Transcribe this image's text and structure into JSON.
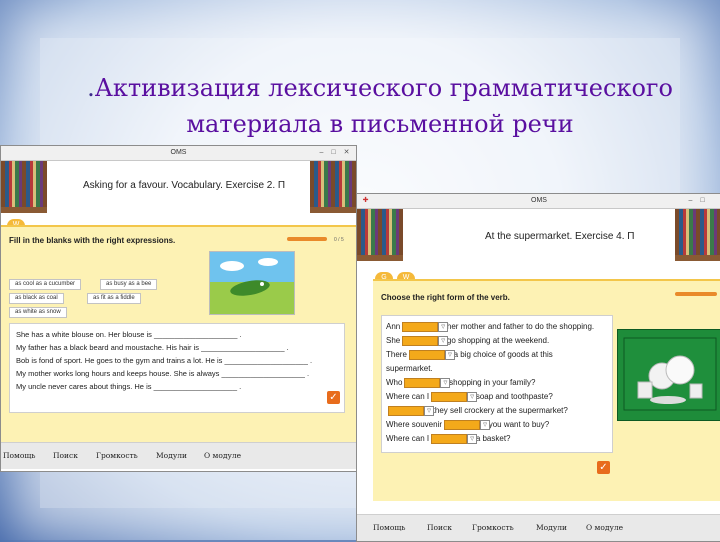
{
  "slide": {
    "title_line1": "Активизация лексического грамматического",
    "title_line2": "материала в письменной речи",
    "title_prefix": "."
  },
  "window1": {
    "titlebar": "OMS",
    "header": "Asking for a favour. Vocabulary. Exercise 2. П",
    "tabs": [
      "W"
    ],
    "instruction": "Fill in the blanks with the right expressions.",
    "progress": "0 / 5",
    "chips": [
      "as cool as a cucumber",
      "as busy as a bee",
      "as black as coal",
      "as fit as a fiddle",
      "as white as snow"
    ],
    "sentences": [
      "She has a white blouse on.  Her blouse is ____________________ .",
      "My father has a black beard and moustache. His hair is ____________________ .",
      "Bob is fond of sport. He goes to the gym and trains a lot. He is ____________________ .",
      "My mother works long hours and keeps house. She is always ____________________ .",
      "My uncle never cares about things. He is ____________________ ."
    ],
    "menu": [
      "Помощь",
      "Поиск",
      "Громкость",
      "Модули",
      "О модуле"
    ]
  },
  "window2": {
    "titlebar": "OMS",
    "header": "At the supermarket. Exercise 4. П",
    "tabs": [
      "G",
      "W"
    ],
    "instruction": "Choose the right form of the verb.",
    "rows": [
      {
        "before": "Ann",
        "after": "her mother and father to do the shopping."
      },
      {
        "before": "She",
        "after": "go shopping at the weekend."
      },
      {
        "before": "There",
        "after": "a big choice of goods at this"
      },
      {
        "before": "supermarket.",
        "after": ""
      },
      {
        "before": "Who",
        "after": "shopping in your family?"
      },
      {
        "before": "Where can I",
        "after": "soap and toothpaste?"
      },
      {
        "before": "",
        "after": "they sell crockery at the supermarket?"
      },
      {
        "before": "Where souvenir",
        "after": "you want to buy?"
      },
      {
        "before": "Where can I",
        "after": "a basket?"
      }
    ],
    "menu": [
      "Помощь",
      "Поиск",
      "Громкость",
      "Модули",
      "О модуле"
    ]
  }
}
